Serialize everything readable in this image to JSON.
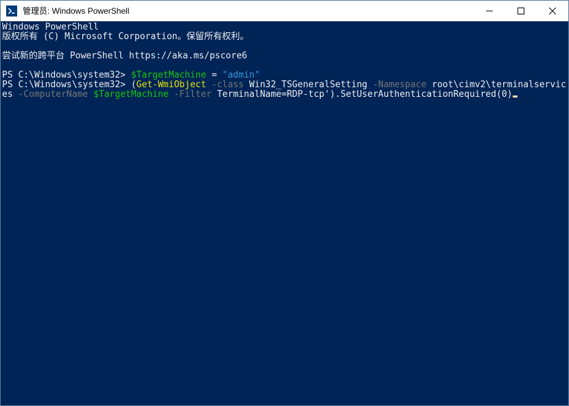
{
  "titlebar": {
    "title": "管理员: Windows PowerShell"
  },
  "terminal": {
    "header1": "Windows PowerShell",
    "header2": "版权所有 (C) Microsoft Corporation。保留所有权利。",
    "teaser": "尝试新的跨平台 PowerShell https://aka.ms/pscore6",
    "prompt": "PS C:\\Windows\\system32>",
    "line1": {
      "var": "$TargetMachine",
      "eq": " = ",
      "val": "\"admin\""
    },
    "line2": {
      "open": "(",
      "cmd": "Get-WmiObject",
      "p1": " -class ",
      "v1": "Win32_TSGeneralSetting",
      "p2": " -Namespace ",
      "v2": "root\\cimv2\\terminalservices",
      "p3": " -ComputerName ",
      "var": "$TargetMachine",
      "p4": " -Filter ",
      "v4": "TerminalName=RDP-tcp').SetUserAuthenticationRequired(0)"
    }
  }
}
